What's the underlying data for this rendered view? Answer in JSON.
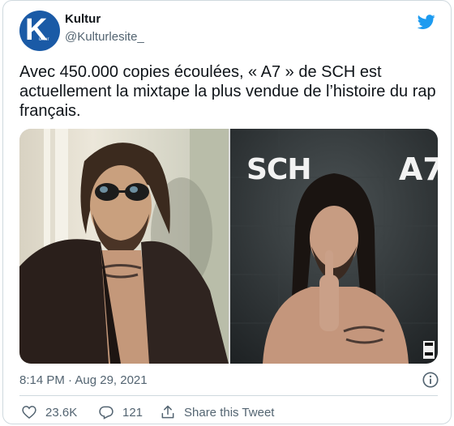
{
  "author": {
    "display_name": "Kultur",
    "handle": "@Kulturlesite_",
    "avatar_letter": "K",
    "avatar_subtitle": "ultur",
    "avatar_color": "#1a5aa6"
  },
  "tweet": {
    "text": "Avec 450.000 copies écoulées, « A7 » de SCH est actuellement la mixtape la plus vendue de l’histoire du rap français.",
    "timestamp": "8:14 PM · Aug 29, 2021"
  },
  "media": {
    "left_image": "photo-man-sunglasses",
    "right_image": "album-cover-a7",
    "cover_logo_left": "SCH",
    "cover_logo_right": "A7"
  },
  "actions": {
    "likes": "23.6K",
    "replies": "121",
    "share_label": "Share this Tweet"
  },
  "colors": {
    "twitter_blue": "#1d9bf0",
    "secondary_text": "#536471",
    "border": "#cfd9de"
  },
  "icons": [
    "twitter-bird-icon",
    "info-icon",
    "heart-icon",
    "reply-icon",
    "share-icon"
  ]
}
